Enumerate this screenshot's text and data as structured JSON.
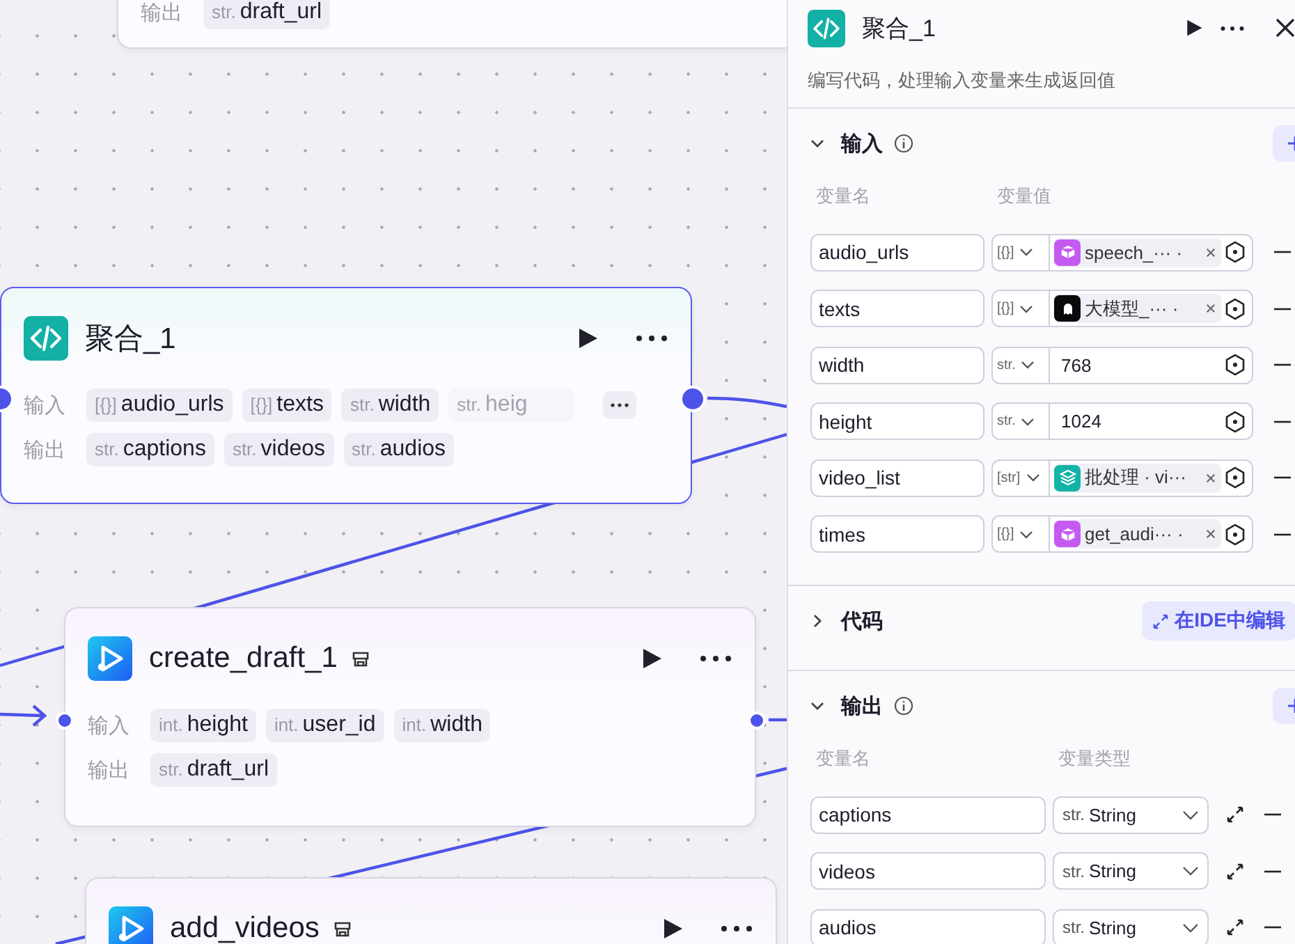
{
  "canvas": {
    "nodes": [
      {
        "kind": "tail",
        "selected": false,
        "rows": [
          {
            "label": "输出",
            "chips": [
              {
                "type": "str.",
                "name": "draft_url",
                "faded": false
              }
            ]
          }
        ]
      },
      {
        "kind": "code",
        "title": "聚合_1",
        "selected": true,
        "rows": [
          {
            "label": "输入",
            "chips": [
              {
                "type": "[{}]",
                "name": "audio_urls",
                "faded": false
              },
              {
                "type": "[{}]",
                "name": "texts",
                "faded": false
              },
              {
                "type": "str.",
                "name": "width",
                "faded": false
              },
              {
                "type": "str.",
                "name": "heig",
                "faded": true
              }
            ],
            "more": true
          },
          {
            "label": "输出",
            "chips": [
              {
                "type": "str.",
                "name": "captions",
                "faded": false
              },
              {
                "type": "str.",
                "name": "videos",
                "faded": false
              },
              {
                "type": "str.",
                "name": "audios",
                "faded": false
              }
            ]
          }
        ]
      },
      {
        "kind": "plugin",
        "title": "create_draft_1",
        "selected": false,
        "rows": [
          {
            "label": "输入",
            "chips": [
              {
                "type": "int.",
                "name": "height",
                "faded": false
              },
              {
                "type": "int.",
                "name": "user_id",
                "faded": false
              },
              {
                "type": "int.",
                "name": "width",
                "faded": false
              }
            ]
          },
          {
            "label": "输出",
            "chips": [
              {
                "type": "str.",
                "name": "draft_url",
                "faded": false
              }
            ]
          }
        ]
      },
      {
        "kind": "plugin",
        "title": "add_videos",
        "selected": false
      }
    ]
  },
  "panel": {
    "title": "聚合_1",
    "description": "编写代码，处理输入变量来生成返回值",
    "sections": [
      {
        "kind": "inputs",
        "title": "输入",
        "expanded": true,
        "columns": [
          "变量名",
          "变量值"
        ],
        "rows": [
          {
            "name": "audio_urls",
            "type": "[{}]",
            "kind": "ref",
            "value": "speech_··· ·",
            "color": "#c55af2"
          },
          {
            "name": "texts",
            "type": "[{}]",
            "kind": "ref",
            "value": "大模型_··· ·",
            "color": "#0a0a0a"
          },
          {
            "name": "width",
            "type": "str.",
            "kind": "literal",
            "value": "768"
          },
          {
            "name": "height",
            "type": "str.",
            "kind": "literal",
            "value": "1024"
          },
          {
            "name": "video_list",
            "type": "[str]",
            "kind": "ref",
            "value": "批处理 · vi···",
            "color": "#13b3a8"
          },
          {
            "name": "times",
            "type": "[{}]",
            "kind": "ref",
            "value": "get_audi··· ·",
            "color": "#c55af2"
          }
        ]
      },
      {
        "kind": "code",
        "title": "代码",
        "expanded": false,
        "action": "在IDE中编辑"
      },
      {
        "kind": "outputs",
        "title": "输出",
        "expanded": true,
        "columns": [
          "变量名",
          "变量类型"
        ],
        "rows": [
          {
            "name": "captions",
            "type": "str.",
            "type_name": "String"
          },
          {
            "name": "videos",
            "type": "str.",
            "type_name": "String"
          },
          {
            "name": "audios",
            "type": "str.",
            "type_name": "String"
          }
        ]
      }
    ]
  }
}
